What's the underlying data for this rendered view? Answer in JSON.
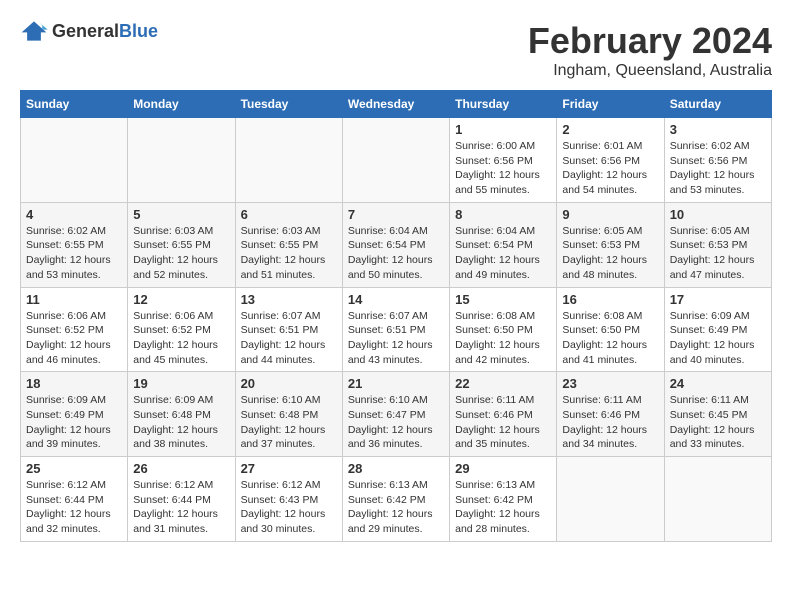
{
  "header": {
    "logo": {
      "text_general": "General",
      "text_blue": "Blue"
    },
    "title": "February 2024",
    "subtitle": "Ingham, Queensland, Australia"
  },
  "days_of_week": [
    "Sunday",
    "Monday",
    "Tuesday",
    "Wednesday",
    "Thursday",
    "Friday",
    "Saturday"
  ],
  "weeks": [
    [
      {
        "day": "",
        "empty": true
      },
      {
        "day": "",
        "empty": true
      },
      {
        "day": "",
        "empty": true
      },
      {
        "day": "",
        "empty": true
      },
      {
        "day": "1",
        "sunrise": "6:00 AM",
        "sunset": "6:56 PM",
        "daylight": "12 hours and 55 minutes."
      },
      {
        "day": "2",
        "sunrise": "6:01 AM",
        "sunset": "6:56 PM",
        "daylight": "12 hours and 54 minutes."
      },
      {
        "day": "3",
        "sunrise": "6:02 AM",
        "sunset": "6:56 PM",
        "daylight": "12 hours and 53 minutes."
      }
    ],
    [
      {
        "day": "4",
        "sunrise": "6:02 AM",
        "sunset": "6:55 PM",
        "daylight": "12 hours and 53 minutes."
      },
      {
        "day": "5",
        "sunrise": "6:03 AM",
        "sunset": "6:55 PM",
        "daylight": "12 hours and 52 minutes."
      },
      {
        "day": "6",
        "sunrise": "6:03 AM",
        "sunset": "6:55 PM",
        "daylight": "12 hours and 51 minutes."
      },
      {
        "day": "7",
        "sunrise": "6:04 AM",
        "sunset": "6:54 PM",
        "daylight": "12 hours and 50 minutes."
      },
      {
        "day": "8",
        "sunrise": "6:04 AM",
        "sunset": "6:54 PM",
        "daylight": "12 hours and 49 minutes."
      },
      {
        "day": "9",
        "sunrise": "6:05 AM",
        "sunset": "6:53 PM",
        "daylight": "12 hours and 48 minutes."
      },
      {
        "day": "10",
        "sunrise": "6:05 AM",
        "sunset": "6:53 PM",
        "daylight": "12 hours and 47 minutes."
      }
    ],
    [
      {
        "day": "11",
        "sunrise": "6:06 AM",
        "sunset": "6:52 PM",
        "daylight": "12 hours and 46 minutes."
      },
      {
        "day": "12",
        "sunrise": "6:06 AM",
        "sunset": "6:52 PM",
        "daylight": "12 hours and 45 minutes."
      },
      {
        "day": "13",
        "sunrise": "6:07 AM",
        "sunset": "6:51 PM",
        "daylight": "12 hours and 44 minutes."
      },
      {
        "day": "14",
        "sunrise": "6:07 AM",
        "sunset": "6:51 PM",
        "daylight": "12 hours and 43 minutes."
      },
      {
        "day": "15",
        "sunrise": "6:08 AM",
        "sunset": "6:50 PM",
        "daylight": "12 hours and 42 minutes."
      },
      {
        "day": "16",
        "sunrise": "6:08 AM",
        "sunset": "6:50 PM",
        "daylight": "12 hours and 41 minutes."
      },
      {
        "day": "17",
        "sunrise": "6:09 AM",
        "sunset": "6:49 PM",
        "daylight": "12 hours and 40 minutes."
      }
    ],
    [
      {
        "day": "18",
        "sunrise": "6:09 AM",
        "sunset": "6:49 PM",
        "daylight": "12 hours and 39 minutes."
      },
      {
        "day": "19",
        "sunrise": "6:09 AM",
        "sunset": "6:48 PM",
        "daylight": "12 hours and 38 minutes."
      },
      {
        "day": "20",
        "sunrise": "6:10 AM",
        "sunset": "6:48 PM",
        "daylight": "12 hours and 37 minutes."
      },
      {
        "day": "21",
        "sunrise": "6:10 AM",
        "sunset": "6:47 PM",
        "daylight": "12 hours and 36 minutes."
      },
      {
        "day": "22",
        "sunrise": "6:11 AM",
        "sunset": "6:46 PM",
        "daylight": "12 hours and 35 minutes."
      },
      {
        "day": "23",
        "sunrise": "6:11 AM",
        "sunset": "6:46 PM",
        "daylight": "12 hours and 34 minutes."
      },
      {
        "day": "24",
        "sunrise": "6:11 AM",
        "sunset": "6:45 PM",
        "daylight": "12 hours and 33 minutes."
      }
    ],
    [
      {
        "day": "25",
        "sunrise": "6:12 AM",
        "sunset": "6:44 PM",
        "daylight": "12 hours and 32 minutes."
      },
      {
        "day": "26",
        "sunrise": "6:12 AM",
        "sunset": "6:44 PM",
        "daylight": "12 hours and 31 minutes."
      },
      {
        "day": "27",
        "sunrise": "6:12 AM",
        "sunset": "6:43 PM",
        "daylight": "12 hours and 30 minutes."
      },
      {
        "day": "28",
        "sunrise": "6:13 AM",
        "sunset": "6:42 PM",
        "daylight": "12 hours and 29 minutes."
      },
      {
        "day": "29",
        "sunrise": "6:13 AM",
        "sunset": "6:42 PM",
        "daylight": "12 hours and 28 minutes."
      },
      {
        "day": "",
        "empty": true
      },
      {
        "day": "",
        "empty": true
      }
    ]
  ]
}
